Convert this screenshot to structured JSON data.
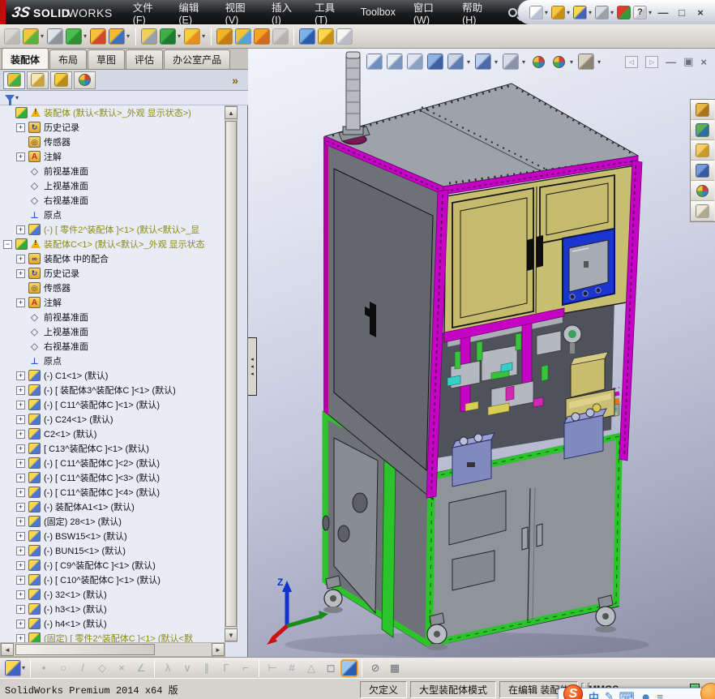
{
  "titlebar": {
    "logo_mark": "3S",
    "brand_bold": "SOLID",
    "brand_light": "WORKS",
    "menus": [
      "文件(F)",
      "编辑(E)",
      "视图(V)",
      "插入(I)",
      "工具(T)",
      "Toolbox",
      "窗口(W)",
      "帮助(H)"
    ],
    "quickbar": [
      {
        "name": "new-document",
        "c1": "#fdfdfd",
        "c2": "#b9c2d4",
        "dd": true
      },
      {
        "name": "open-document",
        "c1": "#f5c63f",
        "c2": "#c78f17",
        "dd": true
      },
      {
        "name": "rebuild-alert",
        "c1": "#ffd84d",
        "c2": "#3e63c0",
        "dd": true
      },
      {
        "name": "print",
        "c1": "#d9dbe0",
        "c2": "#9aa0ac",
        "dd": true
      },
      {
        "name": "options-stoplight",
        "c1": "#e03a2a",
        "c2": "#2f9e3a"
      },
      {
        "name": "help",
        "c1": "#f2f2f2",
        "c2": "#c4c8d2",
        "glyph": "?",
        "dd": true
      }
    ],
    "window_controls": [
      {
        "name": "minimize",
        "glyph": "—"
      },
      {
        "name": "maximize",
        "glyph": "□"
      },
      {
        "name": "close",
        "glyph": "×"
      }
    ]
  },
  "main_toolbar": {
    "icons": [
      {
        "name": "insert-components",
        "c1": "#d8d5cf",
        "c2": "#a8a49c",
        "grayed": true
      },
      {
        "name": "insert-component",
        "c1": "#f5c63f",
        "c2": "#58b23c",
        "dd": true
      },
      {
        "name": "mate",
        "c1": "#dfe3ea",
        "c2": "#8d929c"
      },
      {
        "name": "linear-component-pattern",
        "c1": "#49c04e",
        "c2": "#2e8f33",
        "dd": true
      },
      {
        "name": "smart-fasteners",
        "c1": "#f2c338",
        "c2": "#d2452f"
      },
      {
        "name": "move-component",
        "c1": "#f0bd2f",
        "c2": "#3f6fc4",
        "dd": true
      },
      {
        "sep": true
      },
      {
        "name": "show-hidden-components",
        "c1": "#f2cf5a",
        "c2": "#9aa0aa"
      },
      {
        "name": "assembly-features",
        "c1": "#3fae4a",
        "c2": "#1e7a2c",
        "dd": true
      },
      {
        "name": "reference-geometry",
        "c1": "#f5d03c",
        "c2": "#e88c1f",
        "dd": true
      },
      {
        "sep": true
      },
      {
        "name": "new-motion-study",
        "c1": "#f0b52c",
        "c2": "#c47d12"
      },
      {
        "name": "bill-of-materials",
        "c1": "#f2c338",
        "c2": "#58a0d8"
      },
      {
        "name": "exploded-view",
        "c1": "#f5a623",
        "c2": "#d2691e"
      },
      {
        "name": "explode-line-sketch",
        "c1": "#cfccc6",
        "c2": "#9a978f",
        "grayed": true
      },
      {
        "sep": true
      },
      {
        "name": "instant3d",
        "c1": "#7fb0e8",
        "c2": "#2b5cab"
      },
      {
        "name": "large-assembly-settings",
        "c1": "#ffd84d",
        "c2": "#c89018"
      },
      {
        "name": "take-snapshot",
        "c1": "#f5f5f2",
        "c2": "#b8bcc4"
      }
    ]
  },
  "doc_tabs": {
    "tabs": [
      {
        "label": "装配体",
        "active": true
      },
      {
        "label": "布局",
        "active": false
      },
      {
        "label": "草图",
        "active": false
      },
      {
        "label": "评估",
        "active": false
      },
      {
        "label": "办公室产品",
        "active": false
      }
    ]
  },
  "feature_pane": {
    "pane_tabs": [
      {
        "name": "featuremanager-tree-tab",
        "active": true,
        "kind": "chip",
        "c1": "#f2c338",
        "c2": "#3fae4a"
      },
      {
        "name": "propertymanager-tab",
        "kind": "chip",
        "c1": "#f5e6b8",
        "c2": "#c9a23c"
      },
      {
        "name": "configurationmanager-tab",
        "kind": "chip",
        "c1": "#f5d03c",
        "c2": "#b98a1c"
      },
      {
        "name": "displaymanager-tab",
        "kind": "sphere"
      }
    ],
    "overflow_glyph": "»"
  },
  "tree": {
    "items": [
      {
        "indent": 0,
        "expand": "",
        "icon": "asm",
        "warn": true,
        "label": "装配体 (默认<默认>_外观 显示状态>)",
        "olive": true
      },
      {
        "indent": 1,
        "expand": "+",
        "icon": "history",
        "label": "历史记录"
      },
      {
        "indent": 1,
        "expand": "",
        "icon": "sensors",
        "label": "传感器"
      },
      {
        "indent": 1,
        "expand": "+",
        "icon": "ann",
        "label": "注解"
      },
      {
        "indent": 1,
        "expand": "",
        "icon": "plane",
        "label": "前视基准面"
      },
      {
        "indent": 1,
        "expand": "",
        "icon": "plane",
        "label": "上视基准面"
      },
      {
        "indent": 1,
        "expand": "",
        "icon": "plane",
        "label": "右视基准面"
      },
      {
        "indent": 1,
        "expand": "",
        "icon": "origin",
        "label": "原点"
      },
      {
        "indent": 1,
        "expand": "+",
        "icon": "part",
        "label": "(-) [ 零件2^装配体 ]<1> (默认<默认>_显",
        "olive": true
      },
      {
        "indent": 0,
        "expand": "-",
        "icon": "asm",
        "warn": true,
        "label": "装配体C<1> (默认<默认>_外观 显示状态",
        "olive": true
      },
      {
        "indent": 1,
        "expand": "+",
        "icon": "mates",
        "label": "装配体 中的配合"
      },
      {
        "indent": 1,
        "expand": "+",
        "icon": "history",
        "label": "历史记录"
      },
      {
        "indent": 1,
        "expand": "",
        "icon": "sensors",
        "label": "传感器"
      },
      {
        "indent": 1,
        "expand": "+",
        "icon": "ann",
        "label": "注解"
      },
      {
        "indent": 1,
        "expand": "",
        "icon": "plane",
        "label": "前视基准面"
      },
      {
        "indent": 1,
        "expand": "",
        "icon": "plane",
        "label": "上视基准面"
      },
      {
        "indent": 1,
        "expand": "",
        "icon": "plane",
        "label": "右视基准面"
      },
      {
        "indent": 1,
        "expand": "",
        "icon": "origin",
        "label": "原点"
      },
      {
        "indent": 1,
        "expand": "+",
        "icon": "part",
        "label": "(-) C1<1> (默认)"
      },
      {
        "indent": 1,
        "expand": "+",
        "icon": "part",
        "label": "(-) [ 装配体3^装配体C ]<1> (默认)"
      },
      {
        "indent": 1,
        "expand": "+",
        "icon": "part",
        "label": "(-) [ C11^装配体C ]<1> (默认)"
      },
      {
        "indent": 1,
        "expand": "+",
        "icon": "part",
        "label": "(-) C24<1> (默认)"
      },
      {
        "indent": 1,
        "expand": "+",
        "icon": "part",
        "label": "C2<1> (默认)"
      },
      {
        "indent": 1,
        "expand": "+",
        "icon": "part",
        "label": "[ C13^装配体C ]<1> (默认)"
      },
      {
        "indent": 1,
        "expand": "+",
        "icon": "part",
        "label": "(-) [ C11^装配体C ]<2> (默认)"
      },
      {
        "indent": 1,
        "expand": "+",
        "icon": "part",
        "label": "(-) [ C11^装配体C ]<3> (默认)"
      },
      {
        "indent": 1,
        "expand": "+",
        "icon": "part",
        "label": "(-) [ C11^装配体C ]<4> (默认)"
      },
      {
        "indent": 1,
        "expand": "+",
        "icon": "part",
        "label": "(-) 装配体A1<1> (默认)"
      },
      {
        "indent": 1,
        "expand": "+",
        "icon": "part",
        "label": "(固定) 28<1> (默认)"
      },
      {
        "indent": 1,
        "expand": "+",
        "icon": "part",
        "label": "(-) BSW15<1> (默认)"
      },
      {
        "indent": 1,
        "expand": "+",
        "icon": "part",
        "label": "(-) BUN15<1> (默认)"
      },
      {
        "indent": 1,
        "expand": "+",
        "icon": "part",
        "label": "(-) [ C9^装配体C ]<1> (默认)"
      },
      {
        "indent": 1,
        "expand": "+",
        "icon": "part",
        "label": "(-) [ C10^装配体C ]<1> (默认)"
      },
      {
        "indent": 1,
        "expand": "+",
        "icon": "part",
        "label": "(-) 32<1> (默认)"
      },
      {
        "indent": 1,
        "expand": "+",
        "icon": "part",
        "label": "(-) h3<1> (默认)"
      },
      {
        "indent": 1,
        "expand": "+",
        "icon": "part",
        "label": "(-) h4<1> (默认)"
      },
      {
        "indent": 1,
        "expand": "+",
        "icon": "asm",
        "label": "(固定) [ 零件2^装配体C ]<1> (默认<默",
        "olive": true
      }
    ]
  },
  "viewport": {
    "heads_up": [
      {
        "name": "zoom-to-fit",
        "c1": "#e8edf5",
        "c2": "#6f8fc0"
      },
      {
        "name": "zoom-to-area",
        "c1": "#e8edf5",
        "c2": "#7a94bd"
      },
      {
        "name": "magnified-selection",
        "c1": "#dfe5ef",
        "c2": "#8aa0c4"
      },
      {
        "name": "section-view",
        "c1": "#8fb2e0",
        "c2": "#3f5f9e"
      },
      {
        "name": "view-orientation",
        "c1": "#cdd6e6",
        "c2": "#5d7cb0",
        "dd": true
      },
      {
        "name": "display-style",
        "c1": "#bcd0ea",
        "c2": "#4a6aa8",
        "dd": true
      },
      {
        "name": "hide-show-items",
        "c1": "#d8dde8",
        "c2": "#8a93a8",
        "dd": true
      },
      {
        "name": "edit-appearance",
        "kind": "sphere"
      },
      {
        "name": "apply-scene",
        "kind": "sphere",
        "dd": true
      },
      {
        "name": "view-settings",
        "c1": "#d8d2c2",
        "c2": "#8a8272",
        "dd": true
      }
    ],
    "doc_window_buttons": [
      {
        "name": "pane-previous",
        "glyph": "◁",
        "box": true
      },
      {
        "name": "pane-next",
        "glyph": "▷",
        "box": true
      },
      {
        "name": "doc-minimize",
        "glyph": "—"
      },
      {
        "name": "doc-restore",
        "glyph": "▣"
      },
      {
        "name": "doc-close",
        "glyph": "×"
      }
    ],
    "task_pane_tabs": [
      {
        "name": "home",
        "c1": "#e8b84a",
        "c2": "#a8741c"
      },
      {
        "name": "design-library",
        "c1": "#5fae52",
        "c2": "#2e6ea8"
      },
      {
        "name": "file-explorer",
        "c1": "#f5d06a",
        "c2": "#c79a2a"
      },
      {
        "name": "view-palette",
        "c1": "#7a9ad8",
        "c2": "#3a5aa0"
      },
      {
        "name": "appearances-scenes",
        "kind": "sphere"
      },
      {
        "name": "custom-properties",
        "c1": "#efe9da",
        "c2": "#b0a88f"
      }
    ],
    "triad_z_label": "Z",
    "model_colors": {
      "frame_magenta": "#c503c5",
      "frame_green": "#2bc42b",
      "trim_orange": "#e0761c",
      "door_khaki": "#c9bf70",
      "top_gray": "#9da3ab",
      "left_gray": "#6e7278",
      "front_gray": "#8f949b",
      "interior_dark": "#4f525a",
      "hmi_blue": "#1b35cf",
      "pump_slate": "#8189bf",
      "machinery_gray": "#b4b9c1",
      "part_teal": "#35cfc6",
      "part_yellow": "#d9ce55",
      "part_green": "#38c23c",
      "wheel_gray": "#b9bdc3"
    }
  },
  "bottom_toolbar": {
    "icons": [
      {
        "name": "view-orientation-alert",
        "kind": "chip",
        "c1": "#ffd84d",
        "c2": "#3e63c0",
        "dd": true
      },
      {
        "sep": true
      },
      {
        "name": "sketch-point",
        "glyph": "•",
        "grayed": true
      },
      {
        "name": "sketch-circle",
        "glyph": "○",
        "grayed": true
      },
      {
        "name": "sketch-line",
        "glyph": "/",
        "grayed": true
      },
      {
        "name": "sketch-polygon",
        "glyph": "◇",
        "grayed": true
      },
      {
        "name": "sketch-spline",
        "glyph": "×",
        "grayed": true
      },
      {
        "name": "sketch-angle",
        "glyph": "∠",
        "grayed": true
      },
      {
        "sep": true
      },
      {
        "name": "trim-entities",
        "glyph": "λ",
        "grayed": true
      },
      {
        "name": "convert-entities",
        "glyph": "∨",
        "grayed": true
      },
      {
        "name": "offset-entities",
        "glyph": "∥",
        "grayed": true
      },
      {
        "name": "corner-rectangle",
        "glyph": "Γ",
        "grayed": true
      },
      {
        "name": "centerline",
        "glyph": "⌐",
        "grayed": true
      },
      {
        "sep": true
      },
      {
        "name": "smart-dimension",
        "glyph": "⊢",
        "grayed": true
      },
      {
        "name": "grid-snap",
        "glyph": "#",
        "grayed": true
      },
      {
        "name": "angle-snap",
        "glyph": "△",
        "grayed": true
      },
      {
        "name": "wireframe-view",
        "glyph": "◻"
      },
      {
        "name": "shaded-view",
        "kind": "chip",
        "c1": "#9ec6f0",
        "c2": "#2c5cae",
        "active": true
      },
      {
        "sep": true
      },
      {
        "name": "measure",
        "glyph": "⊘"
      },
      {
        "name": "mass-properties-table",
        "glyph": "▦"
      }
    ]
  },
  "status_bar": {
    "app_version": "SolidWorks Premium 2014 x64 版",
    "state": "欠定义",
    "mode": "大型装配体模式",
    "editing": "在编辑 装配体",
    "units": "MMGS"
  },
  "ime": {
    "logo": "S",
    "buttons": [
      "中",
      "✎",
      "⌨",
      "☻",
      "≡"
    ]
  }
}
